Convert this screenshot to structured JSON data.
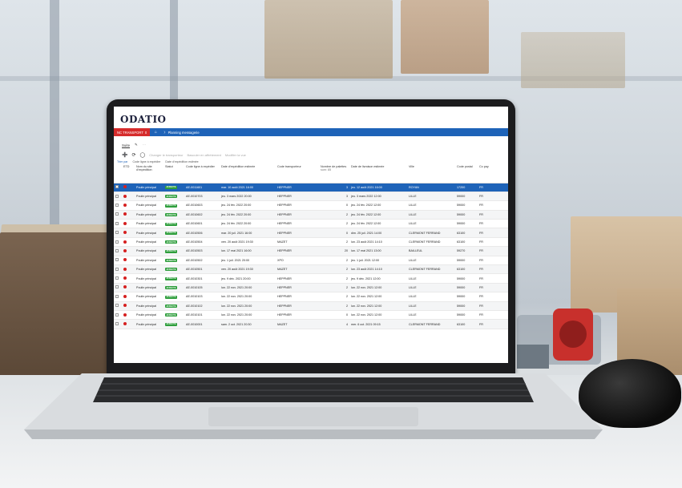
{
  "app": {
    "logo": "ODATIO",
    "nav_tag": "NC TRANSPORT",
    "nav_tag_badge": "0",
    "breadcrumb": "Planning messagerie"
  },
  "toolbar": {
    "menu_label": "Suite",
    "actions": [
      "Changer le transporteur",
      "Basculer en affrètement",
      "Modifier la vue"
    ]
  },
  "grouping": {
    "label": "Trier par",
    "chips": [
      "Code ligne à expédier",
      "Date d'expédition estimée"
    ]
  },
  "table": {
    "headers": [
      "",
      "ETD",
      "Nom du site d'expédition",
      "Statut",
      "Code ligne à expédier",
      "Date d'expédition estimée",
      "Code transporteur",
      "Nombre de palettes",
      "Date de livraison estimée",
      "Ville",
      "Code postal",
      "Co pay"
    ],
    "palettes_sum": "sum: 85",
    "rows": [
      {
        "site": "Poulin principal",
        "status": "AFFECTE",
        "code": "AE-0011601",
        "ship": "mar. 10 août 2021 16:00",
        "carrier": "HEPPNER",
        "pallets": "3",
        "delivery": "jeu. 12 août 2021 16:00",
        "city": "ROYAN",
        "zip": "17200",
        "country": "FR"
      },
      {
        "site": "Poulin principal",
        "status": "AFFECTE",
        "code": "AE-0010703",
        "ship": "jeu. 3 mars 2022 20:00",
        "carrier": "HEPPNER",
        "pallets": "3",
        "delivery": "jeu. 3 mars 2022 12:00",
        "city": "LILLE",
        "zip": "59000",
        "country": "FR"
      },
      {
        "site": "Poulin principal",
        "status": "AFFECTE",
        "code": "AE-0010603",
        "ship": "jeu. 24 fév. 2022 20:00",
        "carrier": "HEPPNER",
        "pallets": "0",
        "delivery": "jeu. 24 fév. 2022 12:00",
        "city": "LILLE",
        "zip": "59000",
        "country": "FR"
      },
      {
        "site": "Poulin principal",
        "status": "AFFECTE",
        "code": "AE-0010602",
        "ship": "jeu. 24 fév. 2022 20:00",
        "carrier": "HEPPNER",
        "pallets": "2",
        "delivery": "jeu. 24 fév. 2022 12:00",
        "city": "LILLE",
        "zip": "59000",
        "country": "FR"
      },
      {
        "site": "Poulin principal",
        "status": "AFFECTE",
        "code": "AE-0010601",
        "ship": "jeu. 24 fév. 2022 20:00",
        "carrier": "HEPPNER",
        "pallets": "2",
        "delivery": "jeu. 24 fév. 2022 12:00",
        "city": "LILLE",
        "zip": "59000",
        "country": "FR"
      },
      {
        "site": "Poulin principal",
        "status": "AFFECTE",
        "code": "AE-0010506",
        "ship": "mar. 20 juil. 2021 16:00",
        "carrier": "HEPPNER",
        "pallets": "0",
        "delivery": "dim. 25 juil. 2021 14:00",
        "city": "CLERMONT FERRAND",
        "zip": "63100",
        "country": "FR"
      },
      {
        "site": "Poulin principal",
        "status": "AFFECTE",
        "code": "AE-0010504",
        "ship": "ven. 20 août 2021 19:30",
        "carrier": "MAZET",
        "pallets": "2",
        "delivery": "lun. 23 août 2021 14:10",
        "city": "CLERMONT FERRAND",
        "zip": "63100",
        "country": "FR"
      },
      {
        "site": "Poulin principal",
        "status": "AFFECTE",
        "code": "AE-0010503",
        "ship": "lun. 17 mai 2021 16:00",
        "carrier": "HEPPNER",
        "pallets": "20",
        "delivery": "lun. 17 mai 2021 13:00",
        "city": "BAILLEUL",
        "zip": "59270",
        "country": "FR"
      },
      {
        "site": "Poulin principal",
        "status": "AFFECTE",
        "code": "AE-0010502",
        "ship": "jeu. 1 juil. 2021 20:00",
        "carrier": "XPO",
        "pallets": "2",
        "delivery": "jeu. 1 juil. 2021 12:00",
        "city": "LILLE",
        "zip": "59000",
        "country": "FR"
      },
      {
        "site": "Poulin principal",
        "status": "AFFECTE",
        "code": "AE-0010501",
        "ship": "ven. 20 août 2021 19:30",
        "carrier": "MAZET",
        "pallets": "2",
        "delivery": "lun. 23 août 2021 14:10",
        "city": "CLERMONT FERRAND",
        "zip": "63100",
        "country": "FR"
      },
      {
        "site": "Poulin principal",
        "status": "AFFECTE",
        "code": "AE-0010301",
        "ship": "jeu. 9 déc. 2021 20:00",
        "carrier": "HEPPNER",
        "pallets": "2",
        "delivery": "jeu. 9 déc. 2021 12:00",
        "city": "LILLE",
        "zip": "59000",
        "country": "FR"
      },
      {
        "site": "Poulin principal",
        "status": "AFFECTE",
        "code": "AE-0010105",
        "ship": "lun. 22 nov. 2021 20:00",
        "carrier": "HEPPNER",
        "pallets": "2",
        "delivery": "lun. 22 nov. 2021 12:00",
        "city": "LILLE",
        "zip": "59000",
        "country": "FR"
      },
      {
        "site": "Poulin principal",
        "status": "AFFECTE",
        "code": "AE-0010103",
        "ship": "lun. 22 nov. 2021 20:00",
        "carrier": "HEPPNER",
        "pallets": "2",
        "delivery": "lun. 22 nov. 2021 12:00",
        "city": "LILLE",
        "zip": "59000",
        "country": "FR"
      },
      {
        "site": "Poulin principal",
        "status": "AFFECTE",
        "code": "AE-0010102",
        "ship": "lun. 22 nov. 2021 20:00",
        "carrier": "HEPPNER",
        "pallets": "2",
        "delivery": "lun. 22 nov. 2021 12:00",
        "city": "LILLE",
        "zip": "59000",
        "country": "FR"
      },
      {
        "site": "Poulin principal",
        "status": "AFFECTE",
        "code": "AE-0010101",
        "ship": "lun. 22 nov. 2021 20:00",
        "carrier": "HEPPNER",
        "pallets": "0",
        "delivery": "lun. 22 nov. 2021 12:00",
        "city": "LILLE",
        "zip": "59000",
        "country": "FR"
      },
      {
        "site": "Poulin principal",
        "status": "AFFECTE",
        "code": "AE-0010001",
        "ship": "sam. 2 oct. 2021 20:30",
        "carrier": "MAZET",
        "pallets": "4",
        "delivery": "mer. 6 oct. 2021 09:15",
        "city": "CLERMONT FERRAND",
        "zip": "63100",
        "country": "FR"
      }
    ]
  },
  "colors": {
    "navbar": "#1e63b8",
    "nav_tag": "#d62b2b",
    "status_badge": "#2e9e3c",
    "etd_dot": "#d62020",
    "selected_row": "#1e63b8"
  }
}
